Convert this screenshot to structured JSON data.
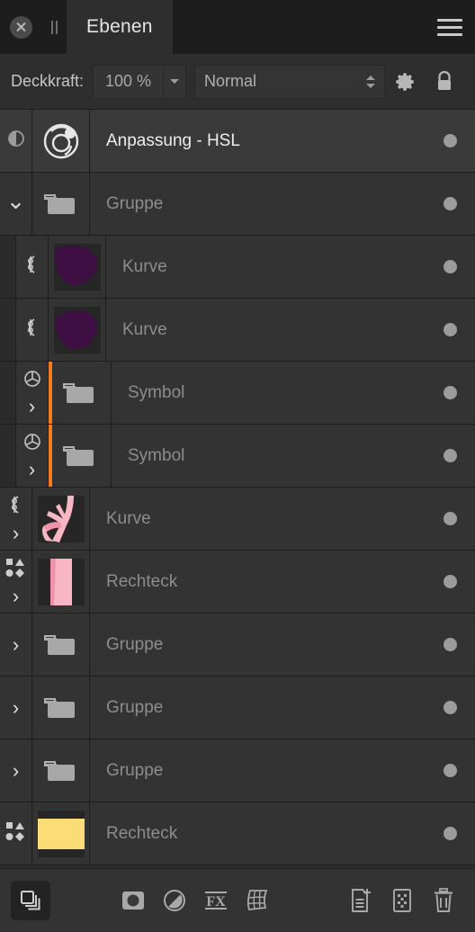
{
  "window": {
    "title": "Ebenen",
    "close_icon": "close-circle-icon",
    "grip_icon": "drag-grip-icon",
    "menu_icon": "hamburger-menu-icon"
  },
  "options": {
    "opacity_label": "Deckkraft:",
    "opacity_value": "100 %",
    "opacity_dropdown_icon": "chevron-down-icon",
    "blend_mode": "Normal",
    "blend_stepper_icon": "stepper-updown-icon",
    "settings_icon": "gear-icon",
    "lock_icon": "lock-icon"
  },
  "layers": [
    {
      "name": "Anpassung - HSL",
      "type": "adjustment",
      "indent": 0,
      "selected": true,
      "active_text": true,
      "left_icon": "adjustment-halfcircle-icon",
      "thumb": "hsl-wheel-icon",
      "expander": "none",
      "symbol_bar": false,
      "visibility_dot": true
    },
    {
      "name": "Gruppe",
      "type": "group",
      "indent": 0,
      "selected": false,
      "active_text": false,
      "left_icon": "none",
      "thumb": "folder-icon",
      "expander": "down",
      "symbol_bar": false,
      "visibility_dot": true
    },
    {
      "name": "Kurve",
      "type": "curve",
      "indent": 1,
      "selected": false,
      "active_text": false,
      "left_icon": "curve-node-icon",
      "thumb": "purple-blob-a",
      "expander": "none",
      "symbol_bar": false,
      "visibility_dot": true
    },
    {
      "name": "Kurve",
      "type": "curve",
      "indent": 1,
      "selected": false,
      "active_text": false,
      "left_icon": "curve-node-icon",
      "thumb": "purple-blob-b",
      "expander": "none",
      "symbol_bar": false,
      "visibility_dot": true
    },
    {
      "name": "Symbol",
      "type": "symbol",
      "indent": 1,
      "selected": false,
      "active_text": false,
      "left_icon": "symbol-icon",
      "thumb": "folder-icon",
      "expander": "right",
      "symbol_bar": true,
      "visibility_dot": true
    },
    {
      "name": "Symbol",
      "type": "symbol",
      "indent": 1,
      "selected": false,
      "active_text": false,
      "left_icon": "symbol-icon",
      "thumb": "folder-icon",
      "expander": "right",
      "symbol_bar": true,
      "visibility_dot": true
    },
    {
      "name": "Kurve",
      "type": "curve",
      "indent": 0,
      "selected": false,
      "active_text": false,
      "left_icon": "curve-node-icon",
      "thumb": "pink-branch",
      "expander": "right",
      "symbol_bar": false,
      "visibility_dot": true
    },
    {
      "name": "Rechteck",
      "type": "rectangle",
      "indent": 0,
      "selected": false,
      "active_text": false,
      "left_icon": "shapes-icon",
      "thumb": "pink-rect",
      "expander": "right",
      "symbol_bar": false,
      "visibility_dot": true
    },
    {
      "name": "Gruppe",
      "type": "group",
      "indent": 0,
      "selected": false,
      "active_text": false,
      "left_icon": "none",
      "thumb": "folder-icon",
      "expander": "right",
      "symbol_bar": false,
      "visibility_dot": true
    },
    {
      "name": "Gruppe",
      "type": "group",
      "indent": 0,
      "selected": false,
      "active_text": false,
      "left_icon": "none",
      "thumb": "folder-icon",
      "expander": "right",
      "symbol_bar": false,
      "visibility_dot": true
    },
    {
      "name": "Gruppe",
      "type": "group",
      "indent": 0,
      "selected": false,
      "active_text": false,
      "left_icon": "none",
      "thumb": "folder-icon",
      "expander": "right",
      "symbol_bar": false,
      "visibility_dot": true
    },
    {
      "name": "Rechteck",
      "type": "rectangle",
      "indent": 0,
      "selected": false,
      "active_text": false,
      "left_icon": "shapes-icon",
      "thumb": "yellow-rect",
      "expander": "none",
      "symbol_bar": false,
      "visibility_dot": true
    }
  ],
  "bottom_toolbar": {
    "left": [
      {
        "icon": "layer-stack-icon",
        "active": true
      }
    ],
    "center": [
      {
        "icon": "mask-layer-icon",
        "active": false
      },
      {
        "icon": "adjustment-layer-icon",
        "active": false
      },
      {
        "icon": "fx-layer-icon",
        "active": false
      },
      {
        "icon": "live-filter-layer-icon",
        "active": false
      }
    ],
    "right": [
      {
        "icon": "new-layer-icon",
        "active": false
      },
      {
        "icon": "new-pixel-layer-icon",
        "active": false
      },
      {
        "icon": "trash-delete-icon",
        "active": false
      }
    ]
  },
  "colors": {
    "panel_bg": "#2e2e2e",
    "row_bg": "#333333",
    "row_selected_bg": "#3a3a3a",
    "titlebar_bg": "#1d1d1d",
    "symbol_accent": "#f47b20",
    "purple_thumb": "#3d0f42",
    "pink_light": "#f8b5c4",
    "pink_dark": "#ef92aa",
    "yellow_thumb": "#fbdc76",
    "text_muted": "#8d8d8d",
    "text_active": "#ededed"
  }
}
